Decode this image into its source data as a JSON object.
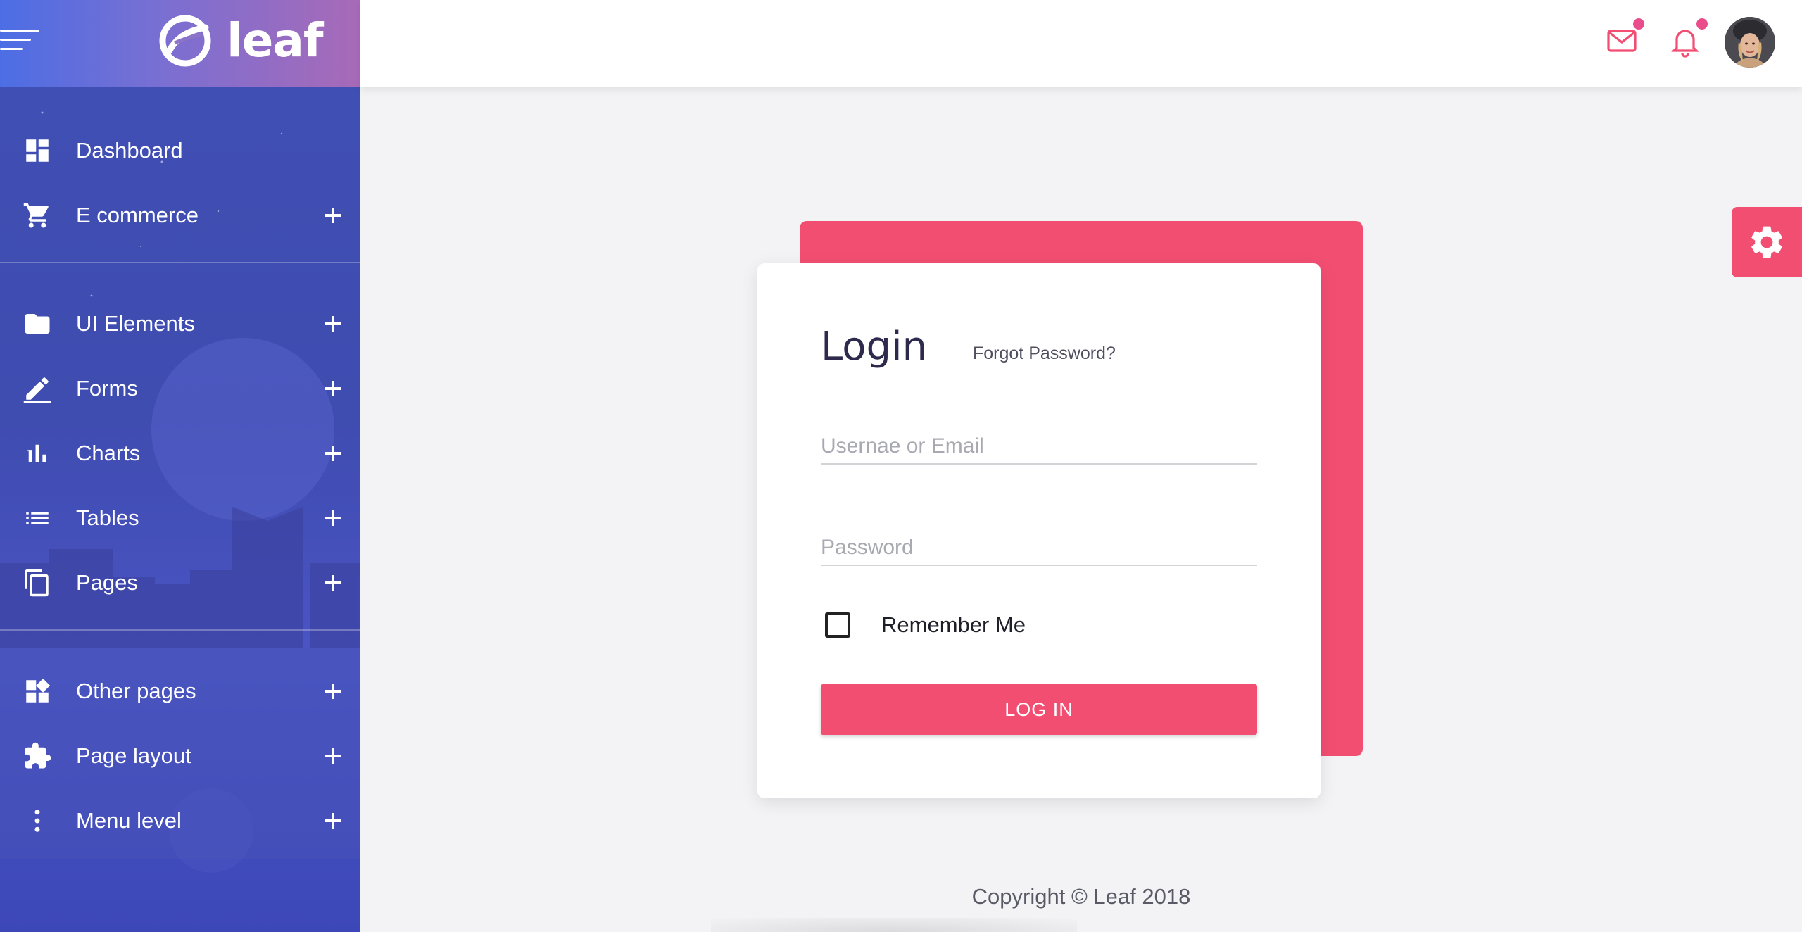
{
  "app": {
    "brand": "leaf",
    "accent_color": "#f24e72",
    "sidebar_color": "#4050b5"
  },
  "sidebar": {
    "menu_icon": "hamburger-icon",
    "groups": [
      {
        "items": [
          {
            "label": "Dashboard",
            "icon": "dashboard-icon",
            "expandable": false
          },
          {
            "label": "E commerce",
            "icon": "cart-icon",
            "expandable": true
          }
        ]
      },
      {
        "items": [
          {
            "label": "UI Elements",
            "icon": "folder-icon",
            "expandable": true
          },
          {
            "label": "Forms",
            "icon": "pencil-icon",
            "expandable": true
          },
          {
            "label": "Charts",
            "icon": "bar-chart-icon",
            "expandable": true
          },
          {
            "label": "Tables",
            "icon": "list-icon",
            "expandable": true
          },
          {
            "label": "Pages",
            "icon": "copy-icon",
            "expandable": true
          }
        ]
      },
      {
        "items": [
          {
            "label": "Other pages",
            "icon": "widgets-icon",
            "expandable": true
          },
          {
            "label": "Page layout",
            "icon": "puzzle-icon",
            "expandable": true
          },
          {
            "label": "Menu level",
            "icon": "more-vertical-icon",
            "expandable": true
          }
        ]
      }
    ]
  },
  "topbar": {
    "icons": [
      "mail-icon",
      "bell-icon"
    ],
    "notification_dot_color": "#e94d8b"
  },
  "login": {
    "title": "Login",
    "forgot_label": "Forgot Password?",
    "username_placeholder": "Usernae or Email",
    "username_value": "",
    "password_placeholder": "Password",
    "password_value": "",
    "remember_label": "Remember Me",
    "remember_checked": false,
    "submit_label": "LOG IN"
  },
  "footer": {
    "text": "Copyright © Leaf 2018"
  }
}
